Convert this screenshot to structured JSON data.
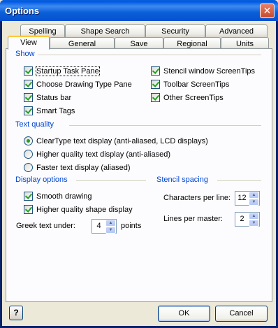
{
  "window": {
    "title": "Options",
    "close_symbol": "✕"
  },
  "tabs_back": [
    "Spelling",
    "Shape Search",
    "Security",
    "Advanced"
  ],
  "tabs_front": [
    "View",
    "General",
    "Save",
    "Regional",
    "Units"
  ],
  "active_tab": "View",
  "show": {
    "label": "Show",
    "items": [
      {
        "label": "Startup Task Pane",
        "checked": true
      },
      {
        "label": "Choose Drawing Type Pane",
        "checked": true
      },
      {
        "label": "Status bar",
        "checked": true
      },
      {
        "label": "Smart Tags",
        "checked": true
      },
      {
        "label": "Stencil window ScreenTips",
        "checked": true
      },
      {
        "label": "Toolbar ScreenTips",
        "checked": true
      },
      {
        "label": "Other ScreenTips",
        "checked": true
      }
    ]
  },
  "text_quality": {
    "label": "Text quality",
    "options": [
      {
        "label": "ClearType text display (anti-aliased, LCD displays)",
        "selected": true
      },
      {
        "label": "Higher quality text display (anti-aliased)",
        "selected": false
      },
      {
        "label": "Faster text display (aliased)",
        "selected": false
      }
    ]
  },
  "display_options": {
    "label": "Display options",
    "items": [
      {
        "label": "Smooth drawing",
        "checked": true
      },
      {
        "label": "Higher quality shape display",
        "checked": true
      }
    ],
    "greek_label": "Greek text under:",
    "greek_value": "4",
    "greek_units": "points"
  },
  "stencil_spacing": {
    "label": "Stencil spacing",
    "chars_label": "Characters per line:",
    "chars_value": "12",
    "lines_label": "Lines per master:",
    "lines_value": "2"
  },
  "buttons": {
    "help": "?",
    "ok": "OK",
    "cancel": "Cancel"
  }
}
